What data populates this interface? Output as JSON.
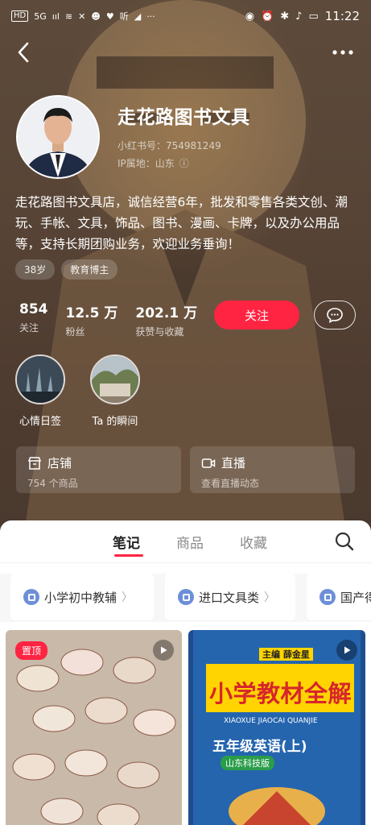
{
  "status_bar": {
    "left_items": [
      "HD",
      "5G",
      "ııl",
      "≋"
    ],
    "ting_label": "听",
    "time": "11:22"
  },
  "profile": {
    "name": "走花路图书文具",
    "redbook_id": "小红书号：754981249",
    "ip_location": "IP属地：山东",
    "bio": "走花路图书文具店，诚信经营6年，批发和零售各类文创、潮玩、手帐、文具，饰品、图书、漫画、卡牌，以及办公用品等，支持长期团购业务，欢迎业务垂询！",
    "tags": [
      "38岁",
      "教育博主"
    ]
  },
  "stats": [
    {
      "value": "854",
      "label": "关注"
    },
    {
      "value": "12.5 万",
      "label": "粉丝"
    },
    {
      "value": "202.1 万",
      "label": "获赞与收藏"
    }
  ],
  "actions": {
    "follow_label": "关注"
  },
  "highlights": [
    {
      "label": "心情日签"
    },
    {
      "label": "Ta 的瞬间"
    }
  ],
  "cards": {
    "shop": {
      "title": "店铺",
      "subtitle": "754 个商品"
    },
    "live": {
      "title": "直播",
      "subtitle": "查看直播动态"
    }
  },
  "tabs": {
    "notes": "笔记",
    "products": "商品",
    "collections": "收藏"
  },
  "chips": [
    {
      "label": "小学初中教辅"
    },
    {
      "label": "进口文具类"
    },
    {
      "label": "国产得"
    }
  ],
  "posts": {
    "pinned_badge": "置顶",
    "book_series": "主编 薛金星",
    "book_title": "小学教材全解",
    "book_pinyin": "XIAOXUE JIAOCAI QUANJIE",
    "book_grade": "五年级英语(上)",
    "book_banner": "山东科技版"
  },
  "colors": {
    "accent": "#ff2442",
    "header_bg": "#574436",
    "chip_icon": "#6d8fd8"
  }
}
